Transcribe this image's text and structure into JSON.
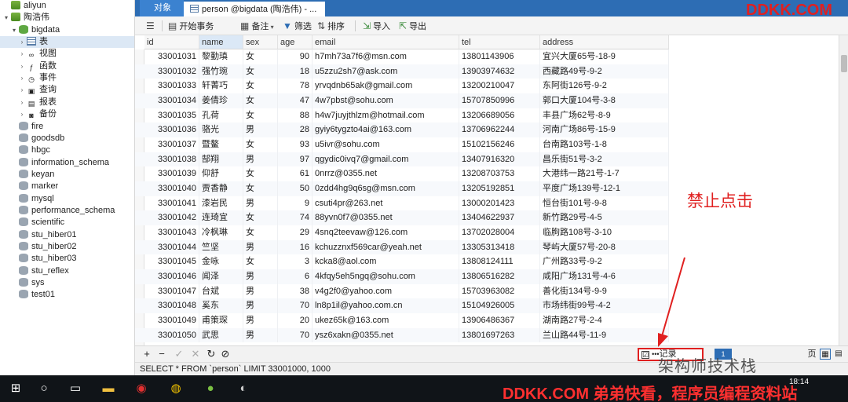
{
  "tree": {
    "items": [
      {
        "label": "aliyun",
        "icon": "connection-icon",
        "twisty": "",
        "indent": 0
      },
      {
        "label": "陶浩伟",
        "icon": "connection-icon",
        "twisty": "▾",
        "indent": 0
      },
      {
        "label": "bigdata",
        "icon": "database-icon",
        "twisty": "▾",
        "indent": 1
      },
      {
        "label": "表",
        "icon": "table-icon",
        "twisty": "›",
        "indent": 2
      },
      {
        "label": "视图",
        "icon": "view-icon",
        "twisty": "›",
        "indent": 2
      },
      {
        "label": "函数",
        "icon": "function-icon",
        "twisty": "›",
        "indent": 2
      },
      {
        "label": "事件",
        "icon": "event-icon",
        "twisty": "›",
        "indent": 2
      },
      {
        "label": "查询",
        "icon": "query-icon",
        "twisty": "›",
        "indent": 2
      },
      {
        "label": "报表",
        "icon": "report-icon",
        "twisty": "›",
        "indent": 2
      },
      {
        "label": "备份",
        "icon": "backup-icon",
        "twisty": "›",
        "indent": 2
      },
      {
        "label": "fire",
        "icon": "database-icon",
        "twisty": "",
        "indent": 1
      },
      {
        "label": "goodsdb",
        "icon": "database-icon",
        "twisty": "",
        "indent": 1
      },
      {
        "label": "hbgc",
        "icon": "database-icon",
        "twisty": "",
        "indent": 1
      },
      {
        "label": "information_schema",
        "icon": "database-icon",
        "twisty": "",
        "indent": 1
      },
      {
        "label": "keyan",
        "icon": "database-icon",
        "twisty": "",
        "indent": 1
      },
      {
        "label": "marker",
        "icon": "database-icon",
        "twisty": "",
        "indent": 1
      },
      {
        "label": "mysql",
        "icon": "database-icon",
        "twisty": "",
        "indent": 1
      },
      {
        "label": "performance_schema",
        "icon": "database-icon",
        "twisty": "",
        "indent": 1
      },
      {
        "label": "scientific",
        "icon": "database-icon",
        "twisty": "",
        "indent": 1
      },
      {
        "label": "stu_hiber01",
        "icon": "database-icon",
        "twisty": "",
        "indent": 1
      },
      {
        "label": "stu_hiber02",
        "icon": "database-icon",
        "twisty": "",
        "indent": 1
      },
      {
        "label": "stu_hiber03",
        "icon": "database-icon",
        "twisty": "",
        "indent": 1
      },
      {
        "label": "stu_reflex",
        "icon": "database-icon",
        "twisty": "",
        "indent": 1
      },
      {
        "label": "sys",
        "icon": "database-icon",
        "twisty": "",
        "indent": 1
      },
      {
        "label": "test01",
        "icon": "database-icon",
        "twisty": "",
        "indent": 1
      }
    ]
  },
  "tabs": {
    "objects": "对象",
    "table": "person @bigdata (陶浩伟) - ..."
  },
  "toolbar": {
    "menu": "☰",
    "begin_tx": "开始事务",
    "note": "备注",
    "filter": "筛选",
    "sort": "排序",
    "import": "导入",
    "export": "导出"
  },
  "grid": {
    "columns": [
      "id",
      "name",
      "sex",
      "age",
      "email",
      "tel",
      "address"
    ],
    "rows": [
      [
        "33001031",
        "黎勤瑱",
        "女",
        "90",
        "h7mh73a7f6@msn.com",
        "13801143906",
        "宜兴大厦65号-18-9"
      ],
      [
        "33001032",
        "强竹琬",
        "女",
        "18",
        "u5zzu2sh7@ask.com",
        "13903974632",
        "西藏路49号-9-2"
      ],
      [
        "33001033",
        "轩菁巧",
        "女",
        "78",
        "yrvqdnb65ak@gmail.com",
        "13200210047",
        "东阿街126号-9-2"
      ],
      [
        "33001034",
        "姜倩珍",
        "女",
        "47",
        "4w7pbst@sohu.com",
        "15707850996",
        "郭口大厦104号-3-8"
      ],
      [
        "33001035",
        "孔荷",
        "女",
        "88",
        "h4w7juyjthlzm@hotmail.com",
        "13206689056",
        "丰县广场62号-8-9"
      ],
      [
        "33001036",
        "骆光",
        "男",
        "28",
        "gyiy6tygzto4ai@163.com",
        "13706962244",
        "河南广场86号-15-9"
      ],
      [
        "33001037",
        "暨鳌",
        "女",
        "93",
        "u5ivr@sohu.com",
        "15102156246",
        "台南路103号-1-8"
      ],
      [
        "33001038",
        "郜翔",
        "男",
        "97",
        "qgydic0ivq7@gmail.com",
        "13407916320",
        "昌乐街51号-3-2"
      ],
      [
        "33001039",
        "仰舒",
        "女",
        "61",
        "0nrrz@0355.net",
        "13208703753",
        "大港纬一路21号-1-7"
      ],
      [
        "33001040",
        "贾香静",
        "女",
        "50",
        "0zdd4hg9q6sg@msn.com",
        "13205192851",
        "平度广场139号-12-1"
      ],
      [
        "33001041",
        "漆岩民",
        "男",
        "9",
        "csuti4pr@263.net",
        "13000201423",
        "恒台街101号-9-8"
      ],
      [
        "33001042",
        "连琦宜",
        "女",
        "74",
        "88yvn0f7@0355.net",
        "13404622937",
        "新竹路29号-4-5"
      ],
      [
        "33001043",
        "冷枫琳",
        "女",
        "29",
        "4snq2teevaw@126.com",
        "13702028004",
        "临朐路108号-3-10"
      ],
      [
        "33001044",
        "竺坚",
        "男",
        "16",
        "kchuzznxf569car@yeah.net",
        "13305313418",
        "琴屿大厦57号-20-8"
      ],
      [
        "33001045",
        "金咏",
        "女",
        "3",
        "kcka8@aol.com",
        "13808124111",
        "广州路33号-9-2"
      ],
      [
        "33001046",
        "闻泽",
        "男",
        "6",
        "4kfqy5eh5ngq@sohu.com",
        "13806516282",
        "咸阳广场131号-4-6"
      ],
      [
        "33001047",
        "台斌",
        "男",
        "38",
        "v4g2f0@yahoo.com",
        "15703963082",
        "善化街134号-9-9"
      ],
      [
        "33001048",
        "奚东",
        "男",
        "70",
        "ln8p1il@yahoo.com.cn",
        "15104926005",
        "市场纬街99号-4-2"
      ],
      [
        "33001049",
        "甫策琛",
        "男",
        "20",
        "ukez65k@163.com",
        "13906486367",
        "湖南路27号-2-4"
      ],
      [
        "33001050",
        "武思",
        "男",
        "70",
        "ysz6xakn@0355.net",
        "13801697263",
        "兰山路44号-11-9"
      ]
    ]
  },
  "gridbar": {
    "add": "+",
    "delete": "−",
    "apply": "✓",
    "cancel": "✕",
    "refresh": "↻",
    "stop": "⊘",
    "records_label": "记录",
    "records_icon": "☑",
    "page_text": "页"
  },
  "status": {
    "sql": "SELECT * FROM `person` LIMIT 33001000, 1000"
  },
  "annotations": {
    "watermark_top": "DDKK.COM",
    "note": "禁止点击",
    "watermark_mid": "架构师技术栈",
    "watermark_bottom": "DDKK.COM 弟弟快看，程序员编程资料站"
  },
  "taskbar": {
    "clock": "18:14",
    "items": [
      "windows-start-icon",
      "search-circle-icon",
      "task-view-icon",
      "file-explorer-icon",
      "netease-music-icon",
      "chrome-icon",
      "navicat-icon",
      "media-icon"
    ]
  },
  "colors": {
    "accent": "#2d6db4",
    "highlight": "#e02020",
    "selected": "#dce8f5"
  }
}
